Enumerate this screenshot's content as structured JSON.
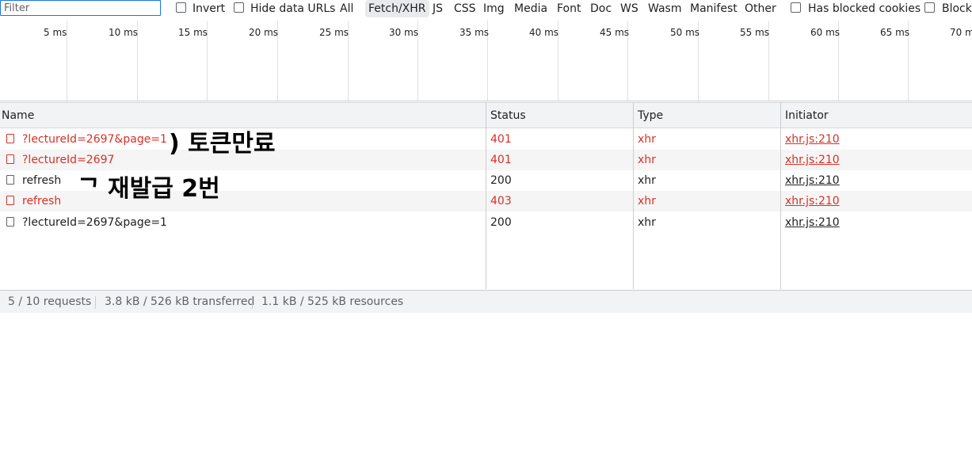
{
  "toolbar": {
    "filter_placeholder": "Filter",
    "invert_label": "Invert",
    "hide_data_urls_label": "Hide data URLs",
    "type_filters": [
      "All",
      "Fetch/XHR",
      "JS",
      "CSS",
      "Img",
      "Media",
      "Font",
      "Doc",
      "WS",
      "Wasm",
      "Manifest",
      "Other"
    ],
    "active_type_filter": "Fetch/XHR",
    "has_blocked_cookies_label": "Has blocked cookies",
    "blocked_requests_label": "Blocke"
  },
  "timeline": {
    "ticks": [
      "5 ms",
      "10 ms",
      "15 ms",
      "20 ms",
      "25 ms",
      "30 ms",
      "35 ms",
      "40 ms",
      "45 ms",
      "50 ms",
      "55 ms",
      "60 ms",
      "65 ms",
      "70 m"
    ]
  },
  "table": {
    "headers": {
      "name": "Name",
      "status": "Status",
      "type": "Type",
      "initiator": "Initiator"
    },
    "rows": [
      {
        "name": "?lectureId=2697&page=1",
        "status": "401",
        "type": "xhr",
        "initiator": "xhr.js:210",
        "error": true
      },
      {
        "name": "?lectureId=2697",
        "status": "401",
        "type": "xhr",
        "initiator": "xhr.js:210",
        "error": true
      },
      {
        "name": "refresh",
        "status": "200",
        "type": "xhr",
        "initiator": "xhr.js:210",
        "error": false
      },
      {
        "name": "refresh",
        "status": "403",
        "type": "xhr",
        "initiator": "xhr.js:210",
        "error": true
      },
      {
        "name": "?lectureId=2697&page=1",
        "status": "200",
        "type": "xhr",
        "initiator": "xhr.js:210",
        "error": false
      }
    ]
  },
  "status_bar": {
    "requests": "5 / 10 requests",
    "transferred": "3.8 kB / 526 kB transferred",
    "resources": "1.1 kB / 525 kB resources"
  },
  "annotations": {
    "first": ") 토큰만료",
    "second": "ᄀ 재발급 2번"
  },
  "colors": {
    "error": "#d93025",
    "accent": "#1a73e8"
  }
}
